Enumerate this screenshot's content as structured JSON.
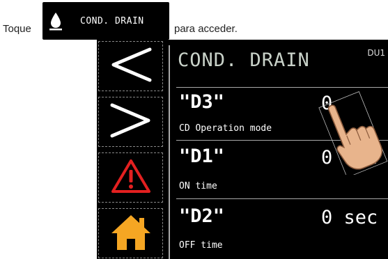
{
  "instruction": {
    "prefix": "Toque",
    "suffix": "para acceder."
  },
  "inline_button": {
    "icon": "water-drop-icon",
    "label": "COND. DRAIN"
  },
  "screen": {
    "title": "COND. DRAIN",
    "unit_tag": "DU1",
    "nav": [
      {
        "name": "back",
        "icon": "chevron-left-icon"
      },
      {
        "name": "forward",
        "icon": "chevron-right-icon"
      },
      {
        "name": "alarm",
        "icon": "warning-icon",
        "color": "#e32020"
      },
      {
        "name": "home",
        "icon": "home-icon",
        "color": "#f5a623"
      }
    ],
    "params": [
      {
        "code": "\"D3\"",
        "desc": "CD Operation mode",
        "value": "0"
      },
      {
        "code": "\"D1\"",
        "desc": "ON time",
        "value": "0 sec"
      },
      {
        "code": "\"D2\"",
        "desc": "OFF time",
        "value": "0 sec"
      }
    ]
  },
  "colors": {
    "screen_bg": "#000000",
    "title_text": "#c9d2c9",
    "warning": "#e32020",
    "home": "#f5a623"
  }
}
